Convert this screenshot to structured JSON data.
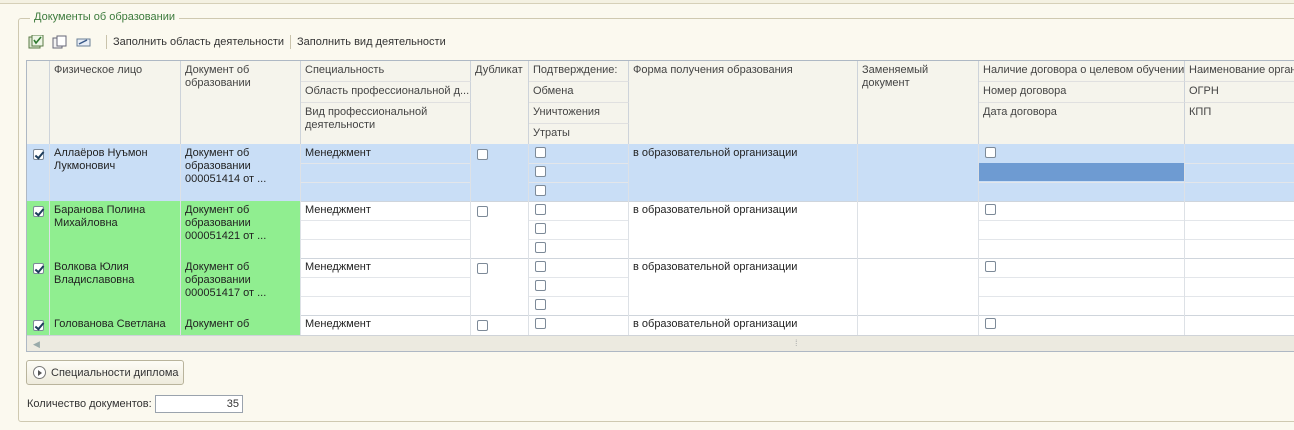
{
  "group": {
    "title": "Документы об образовании"
  },
  "toolbar": {
    "icons": [
      "check-list-icon",
      "copy-icon",
      "edit-icon"
    ],
    "fill_area": "Заполнить область деятельности",
    "fill_kind": "Заполнить вид деятельности"
  },
  "columns": {
    "person": "Физическое лицо",
    "document": "Документ об образовании",
    "specialty": "Специальность",
    "prof_area": "Область профессиональной д...",
    "prof_kind": "Вид профессиональной деятельности",
    "duplicate": "Дубликат",
    "confirm": "Подтверждение:",
    "exchange": "Обмена",
    "destroy": "Уничтожения",
    "loss": "Утраты",
    "form": "Форма получения образования",
    "replaced": "Заменяемый документ",
    "target": "Наличие договора о целевом обучении",
    "contract_no": "Номер договора",
    "contract_date": "Дата договора",
    "org_name": "Наименование орган",
    "ogrn": "ОГРН",
    "kpp": "КПП"
  },
  "rows": [
    {
      "checked": true,
      "person": "Аллаёров Нуъмон Лукмонович",
      "document": "Документ об образовании 000051414 от ...",
      "specialty": "Менеджмент",
      "form": "в образовательной организации",
      "selected": true
    },
    {
      "checked": true,
      "person": "Баранова Полина Михайловна",
      "document": "Документ об образовании 000051421 от ...",
      "specialty": "Менеджмент",
      "form": "в образовательной организации",
      "selected": false
    },
    {
      "checked": true,
      "person": "Волкова Юлия Владиславовна",
      "document": "Документ об образовании 000051417 от ...",
      "specialty": "Менеджмент",
      "form": "в образовательной организации",
      "selected": false
    },
    {
      "checked": true,
      "person": "Голованова Светлана",
      "document": "Документ об",
      "specialty": "Менеджмент",
      "form": "в образовательной организации",
      "selected": false
    }
  ],
  "footer": {
    "specialties_button": "Специальности диплома",
    "count_label": "Количество документов:",
    "count_value": "35"
  }
}
